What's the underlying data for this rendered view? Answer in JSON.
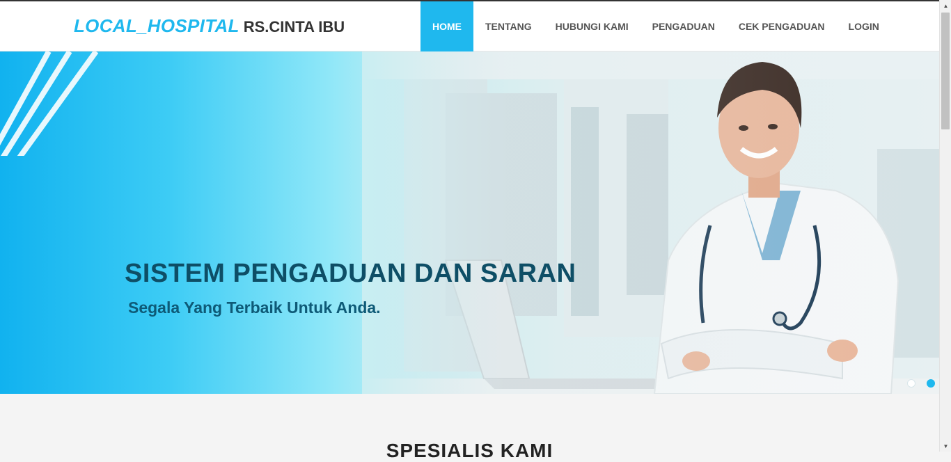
{
  "header": {
    "brand_accent": "LOCAL_HOSPITAL",
    "brand_name": "RS.CINTA IBU"
  },
  "nav": {
    "items": [
      {
        "label": "HOME",
        "active": true
      },
      {
        "label": "TENTANG",
        "active": false
      },
      {
        "label": "HUBUNGI KAMI",
        "active": false
      },
      {
        "label": "PENGADUAN",
        "active": false
      },
      {
        "label": "CEK PENGADUAN",
        "active": false
      },
      {
        "label": "LOGIN",
        "active": false
      }
    ]
  },
  "hero": {
    "title": "SISTEM PENGADUAN DAN SARAN",
    "subtitle": "Segala Yang Terbaik Untuk Anda.",
    "slides": 2,
    "active_slide": 2
  },
  "section": {
    "title": "SPESIALIS KAMI"
  },
  "colors": {
    "accent": "#1fb8ee",
    "hero_text": "#0e4e66",
    "page_bg": "#f4f4f4"
  },
  "icons": {
    "scroll_up": "scroll-up-arrow-icon",
    "scroll_down": "scroll-down-arrow-icon"
  }
}
